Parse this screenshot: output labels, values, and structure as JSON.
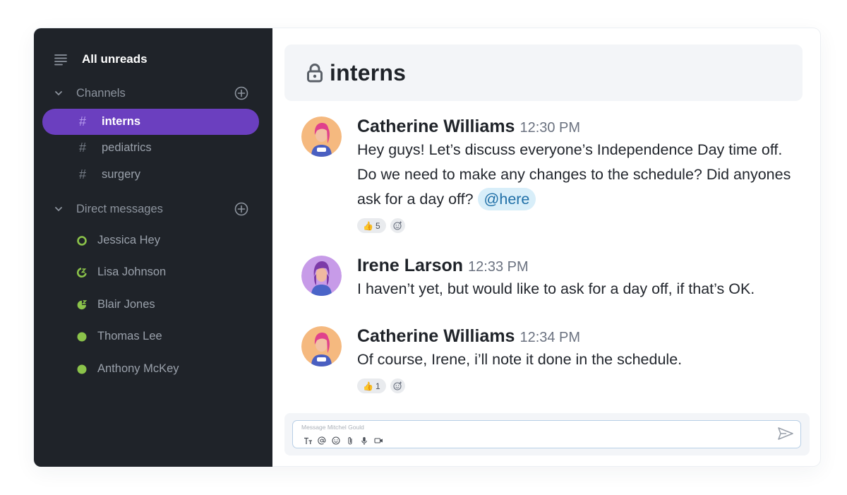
{
  "sidebar": {
    "top_label": "All unreads",
    "channels_section": "Channels",
    "channels": [
      {
        "name": "interns",
        "active": true
      },
      {
        "name": "pediatrics",
        "active": false
      },
      {
        "name": "surgery",
        "active": false
      }
    ],
    "dm_section": "Direct messages",
    "dms": [
      {
        "name": "Jessica Hey",
        "status": "available-outline"
      },
      {
        "name": "Lisa Johnson",
        "status": "away"
      },
      {
        "name": "Blair Jones",
        "status": "snoozed"
      },
      {
        "name": "Thomas Lee",
        "status": "online"
      },
      {
        "name": "Anthony McKey",
        "status": "online"
      }
    ]
  },
  "header": {
    "title": "interns"
  },
  "messages": [
    {
      "author": "Catherine Williams",
      "time": "12:30 PM",
      "text": "Hey guys! Let’s discuss everyone’s Independence Day time off. Do we need to make any changes to the schedule? Did anyones ask for a day off?",
      "mention": "@here",
      "reaction": {
        "emoji": "👍",
        "count": "5"
      }
    },
    {
      "author": "Irene Larson",
      "time": "12:33 PM",
      "text": "I haven’t yet, but would like to ask for a day off, if that’s OK."
    },
    {
      "author": "Catherine Williams",
      "time": "12:34 PM",
      "text": "Of course, Irene, i’ll note it done in the schedule.",
      "reaction": {
        "emoji": "👍",
        "count": "1"
      }
    }
  ],
  "composer": {
    "placeholder": "Message Mitchel Gould"
  },
  "colors": {
    "sidebar_bg": "#1f2329",
    "active_channel": "#6b3fbf",
    "status_green": "#8bc34a",
    "mention_bg": "#d8eef9"
  }
}
